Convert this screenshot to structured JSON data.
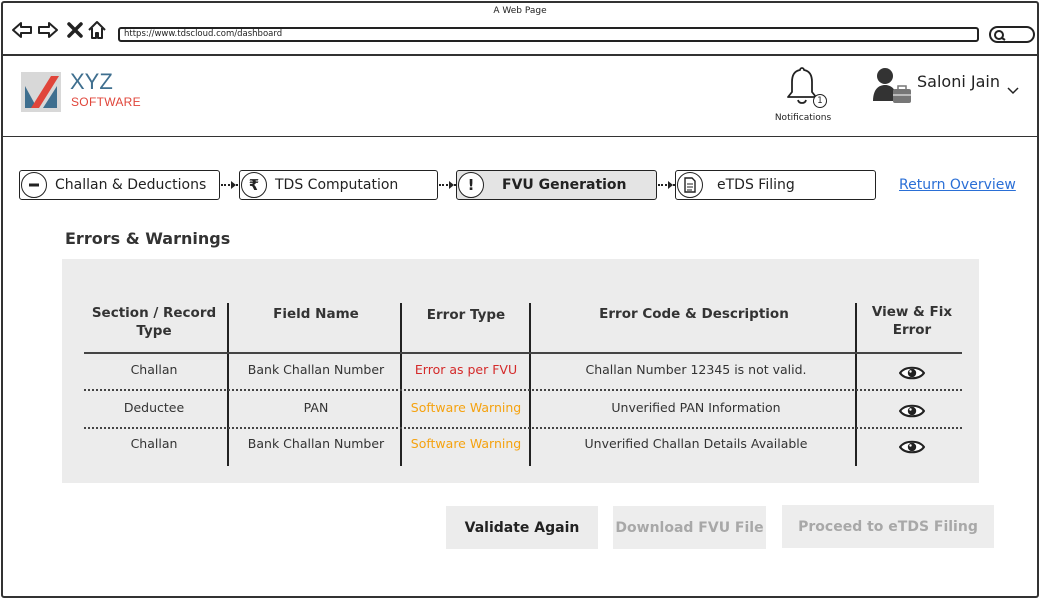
{
  "browser": {
    "window_title": "A Web Page",
    "url": "https://www.tdscloud.com/dashboard",
    "icons": [
      "back-arrow-icon",
      "forward-arrow-icon",
      "close-icon",
      "home-icon",
      "search-icon"
    ]
  },
  "header": {
    "logo_text": "XYZ",
    "logo_subtext": "SOFTWARE",
    "notifications_label": "Notifications",
    "notifications_count": "1",
    "user_name": "Saloni Jain"
  },
  "steps": [
    {
      "label": "Challan & Deductions",
      "icon": "minus-circle-icon",
      "active": false
    },
    {
      "label": "TDS Computation",
      "icon": "rupee-icon",
      "active": false
    },
    {
      "label": "FVU Generation",
      "icon": "exclamation-icon",
      "active": true
    },
    {
      "label": "eTDS Filing",
      "icon": "document-icon",
      "active": false
    }
  ],
  "return_overview_label": "Return Overview",
  "errors": {
    "title": "Errors & Warnings",
    "columns": {
      "section": "Section / Record Type",
      "field": "Field Name",
      "error_type": "Error Type",
      "description": "Error Code & Description",
      "view": "View & Fix Error"
    },
    "rows": [
      {
        "section": "Challan",
        "field": "Bank Challan Number",
        "error_type": "Error as per FVU",
        "description": "Challan Number 12345 is not valid."
      },
      {
        "section": "Deductee",
        "field": "PAN",
        "error_type": "Software Warning",
        "description": "Unverified PAN Information"
      },
      {
        "section": "Challan",
        "field": "Bank Challan Number",
        "error_type": "Software Warning",
        "description": "Unverified Challan Details Available"
      }
    ]
  },
  "actions": {
    "validate_label": "Validate Again",
    "download_label": "Download FVU File",
    "proceed_label": "Proceed to eTDS Filing"
  },
  "colors": {
    "error": "#d42a2a",
    "warning": "#f5a20f",
    "link": "#2a6fd6",
    "logo_blue": "#3f6f8f",
    "logo_red": "#e0453a"
  }
}
